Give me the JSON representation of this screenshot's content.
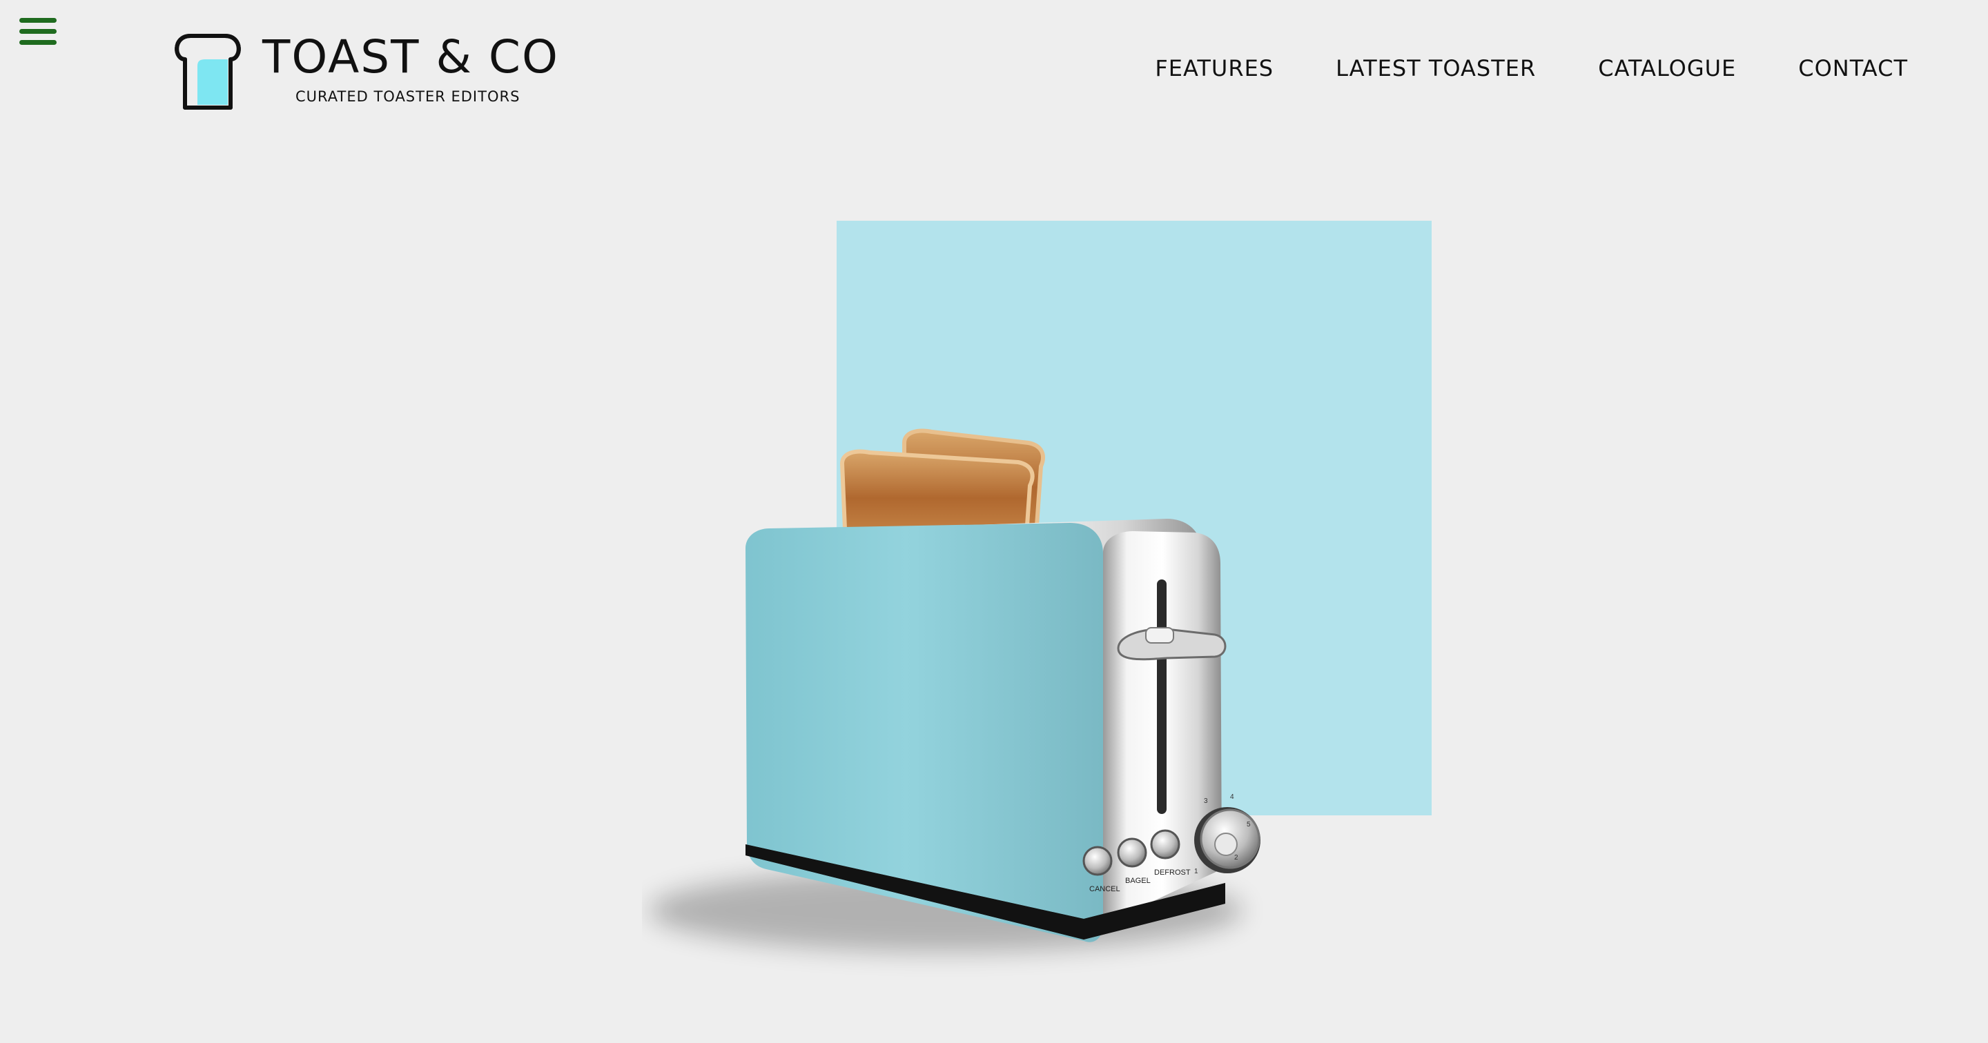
{
  "header": {
    "menu_icon": "hamburger-menu-icon",
    "logo": {
      "icon": "toast-slice-icon",
      "title": "TOAST & CO",
      "tagline": "CURATED TOASTER EDITORS"
    },
    "nav": [
      {
        "label": "FEATURES"
      },
      {
        "label": "LATEST TOASTER"
      },
      {
        "label": "CATALOGUE"
      },
      {
        "label": "CONTACT"
      }
    ]
  },
  "hero": {
    "image": "two-slice-toaster-image",
    "toaster_buttons": [
      "CANCEL",
      "BAGEL",
      "DEFROST"
    ],
    "dial_numbers": [
      "1",
      "2",
      "3",
      "4",
      "5"
    ]
  },
  "colors": {
    "background": "#eeeeee",
    "accent_square": "#b3e3ec",
    "menu_icon": "#1f6b1f",
    "logo_fill": "#7ee6f2",
    "toaster_body": "#8ccfd9"
  }
}
